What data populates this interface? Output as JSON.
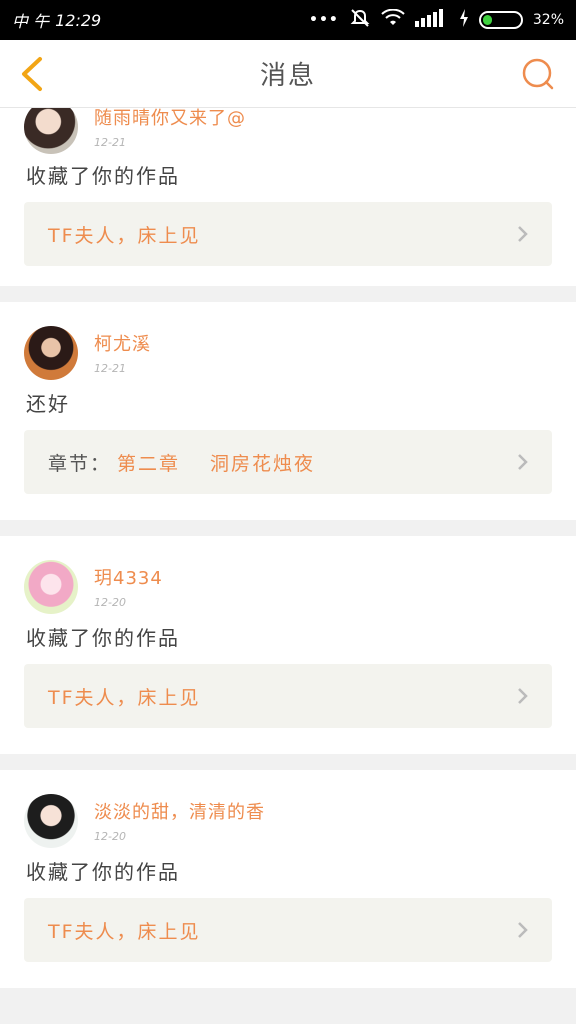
{
  "status_bar": {
    "carrier": "中 午",
    "time": "12:29",
    "dots": "•••",
    "battery_percent": "32%",
    "battery_level": 0.32,
    "icons": [
      "mute-icon",
      "wifi-icon",
      "signal-icon",
      "charging-icon",
      "battery-icon"
    ]
  },
  "header": {
    "title": "消息",
    "back_icon": "chevron-left-icon",
    "search_icon": "search-icon"
  },
  "colors": {
    "accent": "#ee8c4e",
    "box_bg": "#f3f3ee",
    "back": "#f2a515"
  },
  "messages": [
    {
      "user": "随雨晴你又来了@",
      "time": "12-21",
      "text": "收藏了你的作品",
      "work": "TF夫人，床上见"
    },
    {
      "user": "柯尤溪",
      "time": "12-21",
      "text": "还好",
      "chapter_label": "章节：",
      "chapter_no": "第二章",
      "chapter_name": "洞房花烛夜"
    },
    {
      "user": "玥4334",
      "time": "12-20",
      "text": "收藏了你的作品",
      "work": "TF夫人，床上见"
    },
    {
      "user": "淡淡的甜，清清的香",
      "time": "12-20",
      "text": "收藏了你的作品",
      "work": "TF夫人，床上见"
    }
  ]
}
